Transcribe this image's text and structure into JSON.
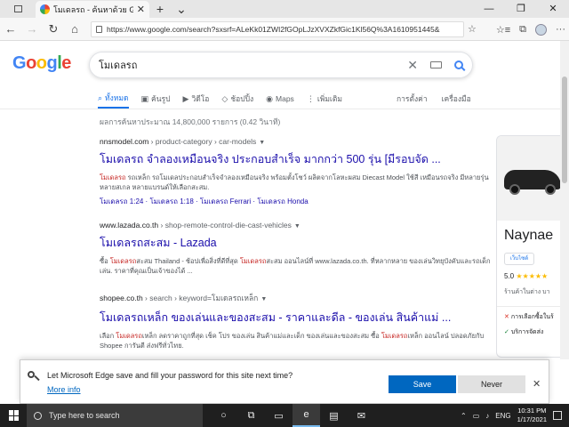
{
  "browser": {
    "tab_title": "โมเดลรถ - ค้นหาด้วย Goog",
    "tab_close": "✕",
    "new_tab": "+",
    "tab_menu": "⌄",
    "url": "https://www.google.com/search?sxsrf=ALeKk01ZWI2fGOpLJzXVXZkfGic1Kl56Q%3A1610951445&"
  },
  "search": {
    "query": "โมเดลรถ",
    "tabs": [
      {
        "label": "ทั้งหมด",
        "icon": "search-icon",
        "active": true
      },
      {
        "label": "ค้นรูป",
        "icon": "image-icon"
      },
      {
        "label": "วิดีโอ",
        "icon": "video-icon"
      },
      {
        "label": "ช้อปปิ้ง",
        "icon": "tag-icon"
      },
      {
        "label": "Maps",
        "icon": "pin-icon"
      },
      {
        "label": "เพิ่มเติม",
        "icon": "more-icon"
      }
    ],
    "settings_label": "การตั้งค่า",
    "tools_label": "เครื่องมือ",
    "stats": "ผลการค้นหาประมาณ 14,800,000 รายการ (0.42 วินาที)"
  },
  "results": [
    {
      "site": "nnsmodel.com",
      "path": " › product-category › car-models",
      "title": "โมเดลรถ จำลองเหมือนจริง ประกอบสำเร็จ มากกว่า 500 รุ่น [มีรอบจัด ...",
      "snippet_parts": [
        {
          "text": "โมเดลรถ",
          "hl": true
        },
        {
          "text": " รถเหล็ก รถโมเดลประกอบสำเร็จจำลองเหมือนจริง พร้อมตั้งโชว์ ผลิตจากโลหะผสม Diecast Model ใช้สี เหมือนรถจริง มีหลายรุ่น หลายสเกล หลายแบรนด์ให้เลือกสะสม.",
          "hl": false
        }
      ],
      "sitelinks": "โมเดลรถ 1:24 · โมเดลรถ 1:18 · โมเดลรถ Ferrari · โมเดลรถ Honda"
    },
    {
      "site": "www.lazada.co.th",
      "path": " › shop-remote-control-die-cast-vehicles",
      "title": "โมเดลรถสะสม - Lazada",
      "snippet_parts": [
        {
          "text": "ซื้อ ",
          "hl": false
        },
        {
          "text": "โมเดลรถ",
          "hl": true
        },
        {
          "text": "สะสม Thailand - ช้อปเพื่อสิ่งที่ดีที่สุด ",
          "hl": false
        },
        {
          "text": "โมเดลรถ",
          "hl": true
        },
        {
          "text": "สะสม ออนไลน์ที่ www.lazada.co.th. ที่หลากหลาย ของเล่นวิทยุบังคับและรถเด็กเล่น. ราคาที่คุณเป็นเจ้าของได้ ...",
          "hl": false
        }
      ],
      "sitelinks": ""
    },
    {
      "site": "shopee.co.th",
      "path": " › search › keyword=โมเดลรถเหล็ก",
      "title": "โมเดลรถเหล็ก ของเล่นและของสะสม - ราคาและดีล - ของเล่น สินค้าแม่ ...",
      "snippet_parts": [
        {
          "text": "เลือก ",
          "hl": false
        },
        {
          "text": "โมเดลรถ",
          "hl": true
        },
        {
          "text": "เหล็ก ลดราคาถูกที่สุด เช็ค โปร ของเล่น สินค้าแม่และเด็ก ของเล่นและของสะสม ซื้อ ",
          "hl": false
        },
        {
          "text": "โมเดลรถ",
          "hl": true
        },
        {
          "text": "เหล็ก ออนไลน์ ปลอดภัยกับ Shopee การันตี ส่งฟรีทั่วไทย.",
          "hl": false
        }
      ],
      "sitelinks": ""
    }
  ],
  "knowledge_panel": {
    "title": "Naynae",
    "button": "เว็บไซต์",
    "rating": "5.0",
    "stars": "★★★★★",
    "status": "ร้านค้าในต่าง บา",
    "opt1": "การเลือกซื้อในร้",
    "opt2": "บริการจัดส่ง"
  },
  "prompt": {
    "message": "Let Microsoft Edge save and fill your password for this site next time?",
    "more_info": "More info",
    "save": "Save",
    "never": "Never",
    "close": "✕"
  },
  "taskbar": {
    "search_placeholder": "Type here to search",
    "lang": "ENG",
    "time": "10:31 PM",
    "date": "1/17/2021"
  }
}
